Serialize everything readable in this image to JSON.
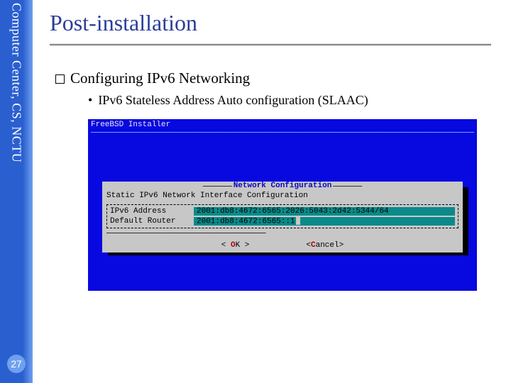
{
  "sidebar": {
    "org_text": "Computer Center, CS, NCTU",
    "page_number": "27"
  },
  "slide": {
    "title": "Post-installation",
    "bullet_q": "Configuring IPv6 Networking",
    "bullet_sub": "IPv6 Stateless Address Auto configuration (SLAAC)"
  },
  "installer": {
    "header": "FreeBSD Installer",
    "rule": "────────────────────────────────────────────────────────────────────────────────────",
    "dialog": {
      "title": "Network Configuration",
      "subtitle": "Static IPv6 Network Interface Configuration",
      "dash": "──────────────────────────────────",
      "fields": [
        {
          "label": "IPv6 Address",
          "value": "2001:db8:4672:6565:2026:5043:2d42:5344/64"
        },
        {
          "label": "Default Router",
          "value": "2001:db8:4672:6565::1"
        }
      ],
      "ok_pre": "<  ",
      "ok_hot": "O",
      "ok_rest": "K  >",
      "cancel_pre": "<",
      "cancel_hot": "C",
      "cancel_rest": "ancel>"
    }
  }
}
